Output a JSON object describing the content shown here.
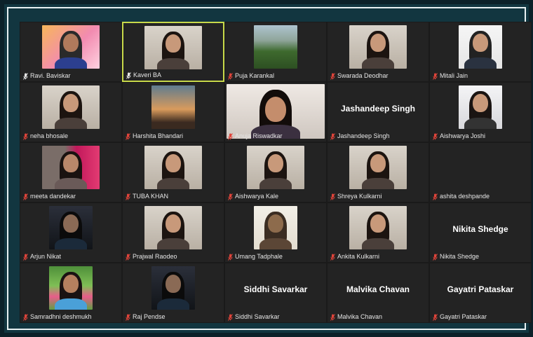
{
  "participants": [
    {
      "name": "Ravi. Baviskar",
      "muted": true,
      "mic_color": "#e8e8e8",
      "video": "flowers",
      "active": false
    },
    {
      "name": "Kaveri BA",
      "muted": true,
      "mic_color": "#e8e8e8",
      "video": "person",
      "active": true
    },
    {
      "name": "Puja Karankal",
      "muted": true,
      "mic_color": "#e0443a",
      "video": "landscape",
      "active": false
    },
    {
      "name": "Swarada Deodhar",
      "muted": true,
      "mic_color": "#e0443a",
      "video": "person",
      "active": false
    },
    {
      "name": "Mitali Jain",
      "muted": true,
      "mic_color": "#e0443a",
      "video": "standing",
      "active": false
    },
    {
      "name": "neha bhosale",
      "muted": true,
      "mic_color": "#e0443a",
      "video": "person",
      "active": false
    },
    {
      "name": "Harshita Bhandari",
      "muted": true,
      "mic_color": "#e0443a",
      "video": "sunset",
      "active": false
    },
    {
      "name": "Anuja Riswadkar",
      "muted": true,
      "mic_color": "#e0443a",
      "video": "person-big",
      "active": false
    },
    {
      "name": "Jashandeep Singh",
      "muted": true,
      "mic_color": "#e0443a",
      "video": "none",
      "display_name": "Jashandeep Singh",
      "active": false
    },
    {
      "name": "Aishwarya Joshi",
      "muted": true,
      "mic_color": "#e0443a",
      "video": "person-light",
      "active": false
    },
    {
      "name": "meeta dandekar",
      "muted": true,
      "mic_color": "#e0443a",
      "video": "person-red",
      "active": false
    },
    {
      "name": "TUBA KHAN",
      "muted": true,
      "mic_color": "#e0443a",
      "video": "person",
      "active": false
    },
    {
      "name": "Aishwarya Kale",
      "muted": true,
      "mic_color": "#e0443a",
      "video": "person",
      "active": false
    },
    {
      "name": "Shreya Kulkarni",
      "muted": true,
      "mic_color": "#e0443a",
      "video": "person",
      "active": false
    },
    {
      "name": "ashita deshpande",
      "muted": true,
      "mic_color": "#e0443a",
      "video": "none-blank",
      "active": false
    },
    {
      "name": "Arjun Nikat",
      "muted": true,
      "mic_color": "#e0443a",
      "video": "person-dark",
      "active": false
    },
    {
      "name": "Prajwal Raodeo",
      "muted": true,
      "mic_color": "#e0443a",
      "video": "person",
      "active": false
    },
    {
      "name": "Umang Tadphale",
      "muted": true,
      "mic_color": "#e0443a",
      "video": "art",
      "active": false
    },
    {
      "name": "Ankita Kulkarni",
      "muted": true,
      "mic_color": "#e0443a",
      "video": "person",
      "active": false
    },
    {
      "name": "Nikita Shedge",
      "muted": true,
      "mic_color": "#e0443a",
      "video": "none",
      "display_name": "Nikita Shedge",
      "active": false
    },
    {
      "name": "Samradhni deshmukh",
      "muted": true,
      "mic_color": "#e0443a",
      "video": "garden",
      "active": false
    },
    {
      "name": "Raj Pendse",
      "muted": true,
      "mic_color": "#e0443a",
      "video": "person-dark",
      "active": false
    },
    {
      "name": "Siddhi Savarkar",
      "muted": true,
      "mic_color": "#e0443a",
      "video": "none",
      "display_name": "Siddhi Savarkar",
      "active": false
    },
    {
      "name": "Malvika Chavan",
      "muted": true,
      "mic_color": "#e0443a",
      "video": "none",
      "display_name": "Malvika Chavan",
      "active": false
    },
    {
      "name": "Gayatri Pataskar",
      "muted": true,
      "mic_color": "#e0443a",
      "video": "none",
      "display_name": "Gayatri Pataskar",
      "active": false
    }
  ],
  "colors": {
    "frame": "#123640",
    "tile": "#232323",
    "active_border": "#c8d94a",
    "muted_mic": "#e0443a"
  }
}
